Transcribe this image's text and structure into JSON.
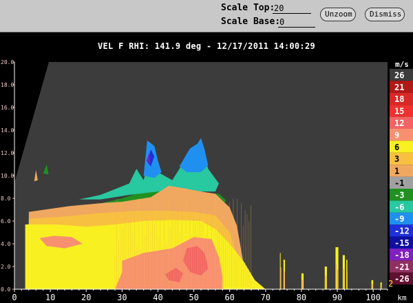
{
  "toolbar": {
    "scale_top_label": "Scale Top:",
    "scale_top_value": "20",
    "scale_base_label": "Scale Base:",
    "scale_base_value": "0",
    "unzoom_label": "Unzoom",
    "dismiss_label": "Dismiss"
  },
  "title": "VEL F  RHI: 141.9 deg  -  12/17/2011 14:00:29",
  "colors": {
    "background": "#000000",
    "plot_bg": "#3c3c3c",
    "toolbar_bg": "#c8c8c8"
  },
  "chart_data": {
    "type": "heatmap",
    "title": "VEL F  RHI: 141.9 deg  -  12/17/2011 14:00:29",
    "xlabel": "km",
    "ylabel": "",
    "xlim": [
      0,
      104
    ],
    "ylim": [
      0,
      20
    ],
    "x_ticks": [
      "0",
      "10",
      "20",
      "30",
      "40",
      "50",
      "60",
      "70",
      "80",
      "90",
      "100"
    ],
    "x_unit_label": "km",
    "y_ticks": [
      "0.0",
      "2.0",
      "4.0",
      "6.0",
      "8.0",
      "10.0",
      "12.0",
      "14.0",
      "16.0",
      "18.0",
      "20.0"
    ],
    "colorbar_unit": "m/s",
    "colorbar": [
      {
        "label": "26",
        "color": "#3c3c3c"
      },
      {
        "label": "21",
        "color": "#b11818"
      },
      {
        "label": "18",
        "color": "#d82828"
      },
      {
        "label": "15",
        "color": "#f03030"
      },
      {
        "label": "12",
        "color": "#f26464"
      },
      {
        "label": "9",
        "color": "#f89070"
      },
      {
        "label": "6",
        "color": "#f8f020"
      },
      {
        "label": "3",
        "color": "#f8c040"
      },
      {
        "label": "1",
        "color": "#f0a860"
      },
      {
        "label": "-1",
        "color": "#a0a0a0"
      },
      {
        "label": "-3",
        "color": "#209020"
      },
      {
        "label": "-6",
        "color": "#28c8a0"
      },
      {
        "label": "-9",
        "color": "#2090f0"
      },
      {
        "label": "-12",
        "color": "#2030d8"
      },
      {
        "label": "-15",
        "color": "#1010a0"
      },
      {
        "label": "-18",
        "color": "#8020c0"
      },
      {
        "label": "-21",
        "color": "#903060"
      },
      {
        "label": "-26",
        "color": "#601030"
      }
    ],
    "corner_annotation": "2"
  }
}
